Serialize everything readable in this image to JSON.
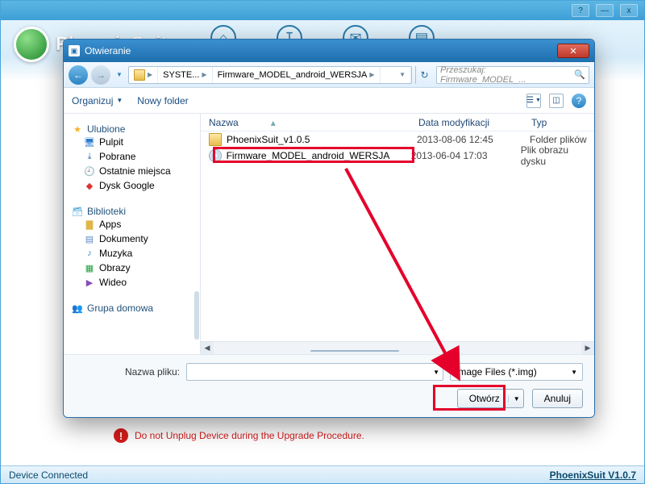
{
  "app": {
    "name": "PhoenixSuit",
    "warning_text": "Do not Unplug Device during the Upgrade Procedure.",
    "status_left": "Device Connected",
    "status_right": "PhoenixSuit V1.0.7"
  },
  "titlebar": {
    "help": "?",
    "min": "—",
    "close": "x"
  },
  "dialog": {
    "title": "Otwieranie",
    "breadcrumb": {
      "seg1": "SYSTE...",
      "seg2": "Firmware_MODEL_android_WERSJA"
    },
    "search_placeholder": "Przeszukaj: Firmware_MODEL_...",
    "toolbar": {
      "organize": "Organizuj",
      "new_folder": "Nowy folder"
    },
    "tree": {
      "fav": "Ulubione",
      "desktop": "Pulpit",
      "downloads": "Pobrane",
      "recent": "Ostatnie miejsca",
      "gdrive": "Dysk Google",
      "libs": "Biblioteki",
      "apps": "Apps",
      "docs": "Dokumenty",
      "music": "Muzyka",
      "pictures": "Obrazy",
      "videos": "Wideo",
      "homegroup": "Grupa domowa"
    },
    "columns": {
      "name": "Nazwa",
      "date": "Data modyfikacji",
      "type": "Typ"
    },
    "rows": [
      {
        "name": "PhoenixSuit_v1.0.5",
        "date": "2013-08-06 12:45",
        "type": "Folder plików",
        "kind": "folder"
      },
      {
        "name": "Firmware_MODEL_android_WERSJA",
        "date": "2013-06-04 17:03",
        "type": "Plik obrazu dysku",
        "kind": "disc"
      }
    ],
    "filename_label": "Nazwa pliku:",
    "filter": "Image Files (*.img)",
    "open": "Otwórz",
    "cancel": "Anuluj"
  }
}
